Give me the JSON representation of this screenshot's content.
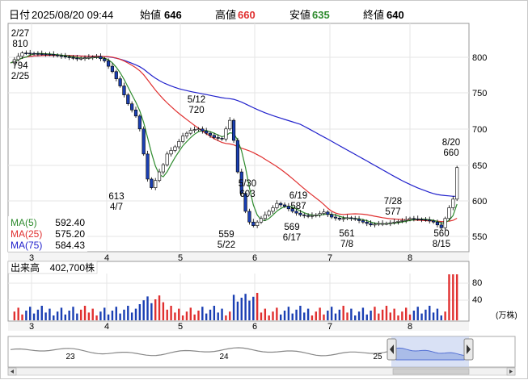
{
  "header": {
    "datetime_label": "日付",
    "datetime": "2025/08/20 09:44",
    "open_label": "始値",
    "open": "646",
    "high_label": "高値",
    "high": "660",
    "low_label": "安値",
    "low": "635",
    "close_label": "終値",
    "close": "640",
    "colors": {
      "high": "#e03030",
      "low": "#2e8b2e",
      "text": "#000000"
    }
  },
  "price_axis": {
    "ticks": [
      "800",
      "750",
      "700",
      "650",
      "600",
      "550"
    ]
  },
  "month_axis": {
    "labels": [
      "3",
      "4",
      "5",
      "6",
      "7",
      "8"
    ]
  },
  "annotations": [
    {
      "id": "feb27",
      "lines": [
        "2/27",
        "810"
      ]
    },
    {
      "id": "feb25",
      "lines": [
        "794",
        "2/25"
      ]
    },
    {
      "id": "apr7",
      "lines": [
        "613",
        "4/7"
      ]
    },
    {
      "id": "may12",
      "lines": [
        "5/12",
        "720"
      ]
    },
    {
      "id": "may22",
      "lines": [
        "559",
        "5/22"
      ]
    },
    {
      "id": "may30",
      "lines": [
        "5/30",
        "603"
      ]
    },
    {
      "id": "jun19",
      "lines": [
        "6/19",
        "587"
      ]
    },
    {
      "id": "jun17",
      "lines": [
        "569",
        "6/17"
      ]
    },
    {
      "id": "jul8",
      "lines": [
        "561",
        "7/8"
      ]
    },
    {
      "id": "jul28",
      "lines": [
        "7/28",
        "577"
      ]
    },
    {
      "id": "aug15",
      "lines": [
        "560",
        "8/15"
      ]
    },
    {
      "id": "aug20",
      "lines": [
        "8/20",
        "660"
      ]
    }
  ],
  "moving_averages": [
    {
      "label": "MA(5)",
      "value": "592.40",
      "color": "#2e8b2e"
    },
    {
      "label": "MA(25)",
      "value": "575.20",
      "color": "#e03030"
    },
    {
      "label": "MA(75)",
      "value": "584.43",
      "color": "#2222cc"
    }
  ],
  "volume": {
    "label": "出来高",
    "value": "402,700株",
    "ticks": [
      "80",
      "40"
    ],
    "unit": "(万株)"
  },
  "navigator": {
    "labels": [
      "23",
      "24",
      "25"
    ]
  },
  "colors": {
    "up": "#ffffff",
    "down": "#1a3fb3",
    "vol_up": "#e03030",
    "vol_down": "#1a3fb3",
    "grid": "#e6e6e6"
  }
}
